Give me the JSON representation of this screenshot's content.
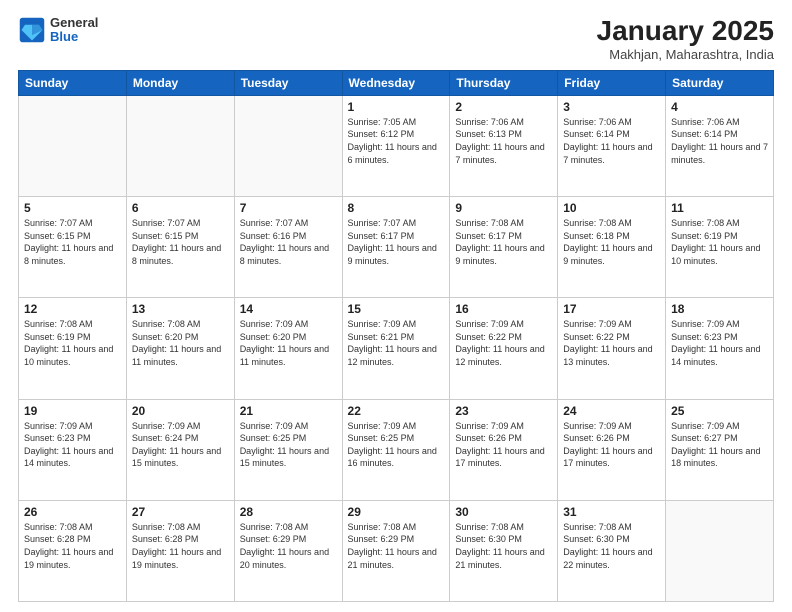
{
  "header": {
    "logo": {
      "general": "General",
      "blue": "Blue"
    },
    "title": "January 2025",
    "location": "Makhjan, Maharashtra, India"
  },
  "days_of_week": [
    "Sunday",
    "Monday",
    "Tuesday",
    "Wednesday",
    "Thursday",
    "Friday",
    "Saturday"
  ],
  "weeks": [
    [
      {
        "day": "",
        "info": ""
      },
      {
        "day": "",
        "info": ""
      },
      {
        "day": "",
        "info": ""
      },
      {
        "day": "1",
        "info": "Sunrise: 7:05 AM\nSunset: 6:12 PM\nDaylight: 11 hours\nand 6 minutes."
      },
      {
        "day": "2",
        "info": "Sunrise: 7:06 AM\nSunset: 6:13 PM\nDaylight: 11 hours\nand 7 minutes."
      },
      {
        "day": "3",
        "info": "Sunrise: 7:06 AM\nSunset: 6:14 PM\nDaylight: 11 hours\nand 7 minutes."
      },
      {
        "day": "4",
        "info": "Sunrise: 7:06 AM\nSunset: 6:14 PM\nDaylight: 11 hours\nand 7 minutes."
      }
    ],
    [
      {
        "day": "5",
        "info": "Sunrise: 7:07 AM\nSunset: 6:15 PM\nDaylight: 11 hours\nand 8 minutes."
      },
      {
        "day": "6",
        "info": "Sunrise: 7:07 AM\nSunset: 6:15 PM\nDaylight: 11 hours\nand 8 minutes."
      },
      {
        "day": "7",
        "info": "Sunrise: 7:07 AM\nSunset: 6:16 PM\nDaylight: 11 hours\nand 8 minutes."
      },
      {
        "day": "8",
        "info": "Sunrise: 7:07 AM\nSunset: 6:17 PM\nDaylight: 11 hours\nand 9 minutes."
      },
      {
        "day": "9",
        "info": "Sunrise: 7:08 AM\nSunset: 6:17 PM\nDaylight: 11 hours\nand 9 minutes."
      },
      {
        "day": "10",
        "info": "Sunrise: 7:08 AM\nSunset: 6:18 PM\nDaylight: 11 hours\nand 9 minutes."
      },
      {
        "day": "11",
        "info": "Sunrise: 7:08 AM\nSunset: 6:19 PM\nDaylight: 11 hours\nand 10 minutes."
      }
    ],
    [
      {
        "day": "12",
        "info": "Sunrise: 7:08 AM\nSunset: 6:19 PM\nDaylight: 11 hours\nand 10 minutes."
      },
      {
        "day": "13",
        "info": "Sunrise: 7:08 AM\nSunset: 6:20 PM\nDaylight: 11 hours\nand 11 minutes."
      },
      {
        "day": "14",
        "info": "Sunrise: 7:09 AM\nSunset: 6:20 PM\nDaylight: 11 hours\nand 11 minutes."
      },
      {
        "day": "15",
        "info": "Sunrise: 7:09 AM\nSunset: 6:21 PM\nDaylight: 11 hours\nand 12 minutes."
      },
      {
        "day": "16",
        "info": "Sunrise: 7:09 AM\nSunset: 6:22 PM\nDaylight: 11 hours\nand 12 minutes."
      },
      {
        "day": "17",
        "info": "Sunrise: 7:09 AM\nSunset: 6:22 PM\nDaylight: 11 hours\nand 13 minutes."
      },
      {
        "day": "18",
        "info": "Sunrise: 7:09 AM\nSunset: 6:23 PM\nDaylight: 11 hours\nand 14 minutes."
      }
    ],
    [
      {
        "day": "19",
        "info": "Sunrise: 7:09 AM\nSunset: 6:23 PM\nDaylight: 11 hours\nand 14 minutes."
      },
      {
        "day": "20",
        "info": "Sunrise: 7:09 AM\nSunset: 6:24 PM\nDaylight: 11 hours\nand 15 minutes."
      },
      {
        "day": "21",
        "info": "Sunrise: 7:09 AM\nSunset: 6:25 PM\nDaylight: 11 hours\nand 15 minutes."
      },
      {
        "day": "22",
        "info": "Sunrise: 7:09 AM\nSunset: 6:25 PM\nDaylight: 11 hours\nand 16 minutes."
      },
      {
        "day": "23",
        "info": "Sunrise: 7:09 AM\nSunset: 6:26 PM\nDaylight: 11 hours\nand 17 minutes."
      },
      {
        "day": "24",
        "info": "Sunrise: 7:09 AM\nSunset: 6:26 PM\nDaylight: 11 hours\nand 17 minutes."
      },
      {
        "day": "25",
        "info": "Sunrise: 7:09 AM\nSunset: 6:27 PM\nDaylight: 11 hours\nand 18 minutes."
      }
    ],
    [
      {
        "day": "26",
        "info": "Sunrise: 7:08 AM\nSunset: 6:28 PM\nDaylight: 11 hours\nand 19 minutes."
      },
      {
        "day": "27",
        "info": "Sunrise: 7:08 AM\nSunset: 6:28 PM\nDaylight: 11 hours\nand 19 minutes."
      },
      {
        "day": "28",
        "info": "Sunrise: 7:08 AM\nSunset: 6:29 PM\nDaylight: 11 hours\nand 20 minutes."
      },
      {
        "day": "29",
        "info": "Sunrise: 7:08 AM\nSunset: 6:29 PM\nDaylight: 11 hours\nand 21 minutes."
      },
      {
        "day": "30",
        "info": "Sunrise: 7:08 AM\nSunset: 6:30 PM\nDaylight: 11 hours\nand 21 minutes."
      },
      {
        "day": "31",
        "info": "Sunrise: 7:08 AM\nSunset: 6:30 PM\nDaylight: 11 hours\nand 22 minutes."
      },
      {
        "day": "",
        "info": ""
      }
    ]
  ]
}
